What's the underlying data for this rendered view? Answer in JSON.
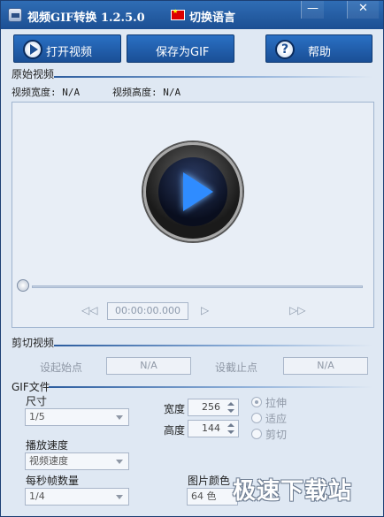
{
  "titlebar": {
    "title": "视频GIF转换 1.2.5.0",
    "lang_button": "切换语言",
    "minimize_glyph": "—",
    "close_glyph": "✕"
  },
  "toolbar": {
    "open_label": "打开视频",
    "save_label": "保存为GIF",
    "help_label": "帮助",
    "help_glyph": "?"
  },
  "source": {
    "section_title": "原始视频",
    "width_label": "视频宽度: N/A",
    "height_label": "视频高度: N/A"
  },
  "player": {
    "rewind_glyph": "◁◁",
    "time": "00:00:00.000",
    "play_glyph": "▷",
    "forward_glyph": "▷▷"
  },
  "trim": {
    "section_title": "剪切视频",
    "start_label": "设起始点",
    "start_value": "N/A",
    "end_label": "设截止点",
    "end_value": "N/A"
  },
  "gif": {
    "section_title": "GIF文件",
    "size_label": "尺寸",
    "size_value": "1/5",
    "width_label": "宽度",
    "width_value": "256",
    "height_label": "高度",
    "height_value": "144",
    "mode_options": [
      "拉伸",
      "适应",
      "剪切"
    ],
    "speed_label": "播放速度",
    "speed_value": "视频速度",
    "fps_label": "每秒帧数量",
    "fps_value": "1/4",
    "color_label": "图片颜色",
    "color_value": "64 色"
  },
  "watermark": "极速下载站",
  "colors": {
    "titlebar": "#1c4f93",
    "button": "#1a4f96",
    "accent_play": "#2f8cff"
  }
}
